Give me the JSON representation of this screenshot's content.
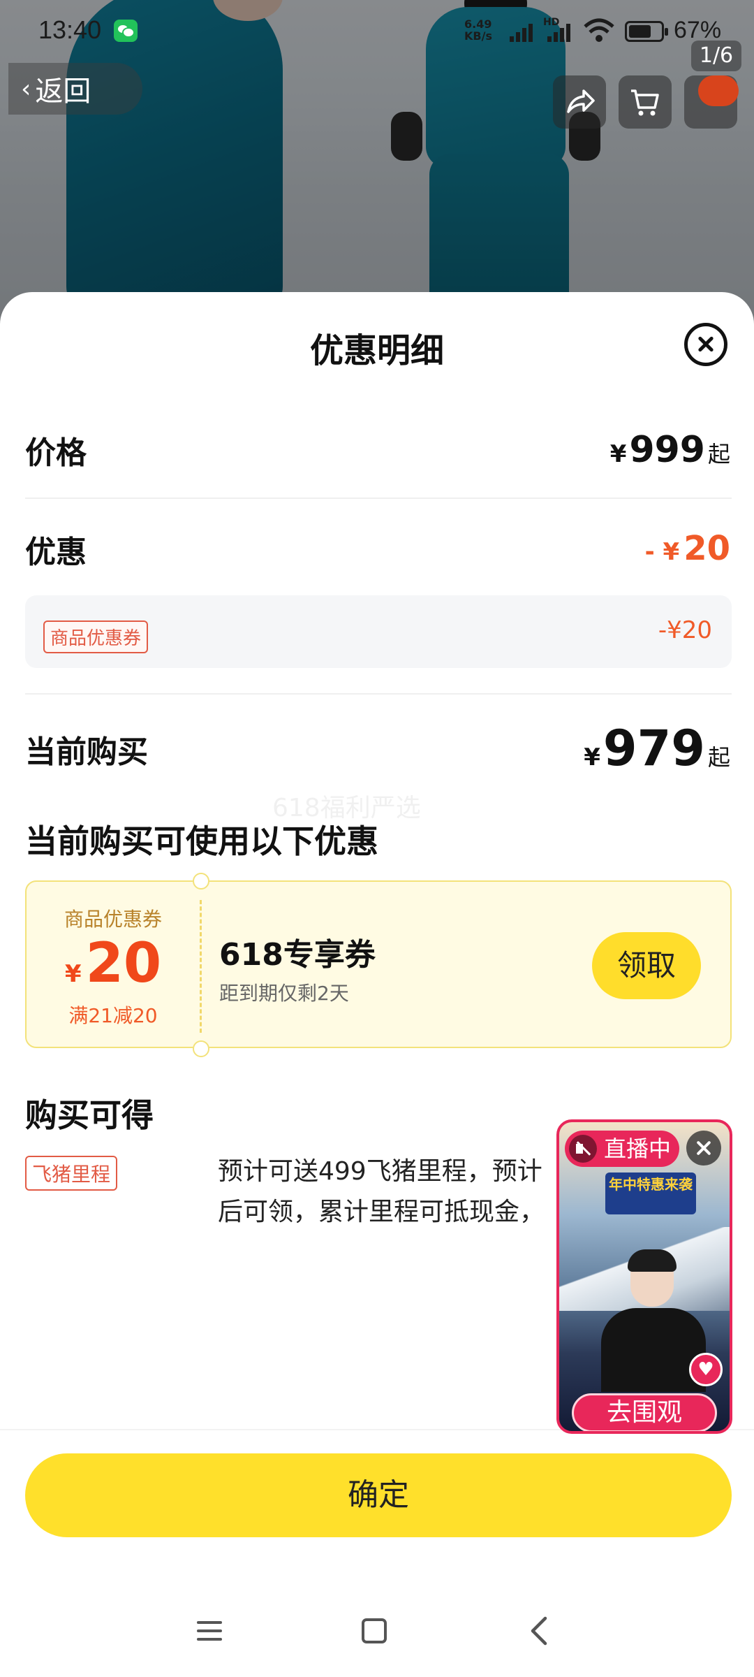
{
  "status_bar": {
    "time": "13:40",
    "network_speed": "6.49 KB/s",
    "network_type": "HD",
    "battery_percent": "67%",
    "battery_level": 0.67
  },
  "top_nav": {
    "back_label": "返回",
    "image_counter": "1/6"
  },
  "sheet": {
    "title": "优惠明细",
    "price": {
      "label": "价格",
      "currency": "¥",
      "value": "999",
      "suffix": "起"
    },
    "discount": {
      "label": "优惠",
      "prefix": "- ¥",
      "value": "20"
    },
    "coupon_line": {
      "tag": "商品优惠券",
      "value": "-¥20"
    },
    "current": {
      "label": "当前购买",
      "currency": "¥",
      "value": "979",
      "suffix": "起"
    },
    "watermark": "618福利严选",
    "available_title": "当前购买可使用以下优惠",
    "coupon_card": {
      "type_label": "商品优惠券",
      "currency": "¥",
      "amount": "20",
      "condition": "满21减20",
      "name": "618专享券",
      "expiry": "距到期仅剩2天",
      "claim_label": "领取"
    },
    "earn_title": "购买可得",
    "miles": {
      "tag": "飞猪里程",
      "line1": "预计可送499飞猪里程，预计",
      "line2": "后可领，累计里程可抵现金，"
    }
  },
  "live": {
    "badge": "直播中",
    "banner": "年中特惠来袭",
    "cta": "去围观"
  },
  "footer": {
    "confirm_label": "确定"
  },
  "colors": {
    "accent_yellow": "#ffdd2b",
    "discount_red": "#f05a28",
    "live_pink": "#e8275a"
  }
}
